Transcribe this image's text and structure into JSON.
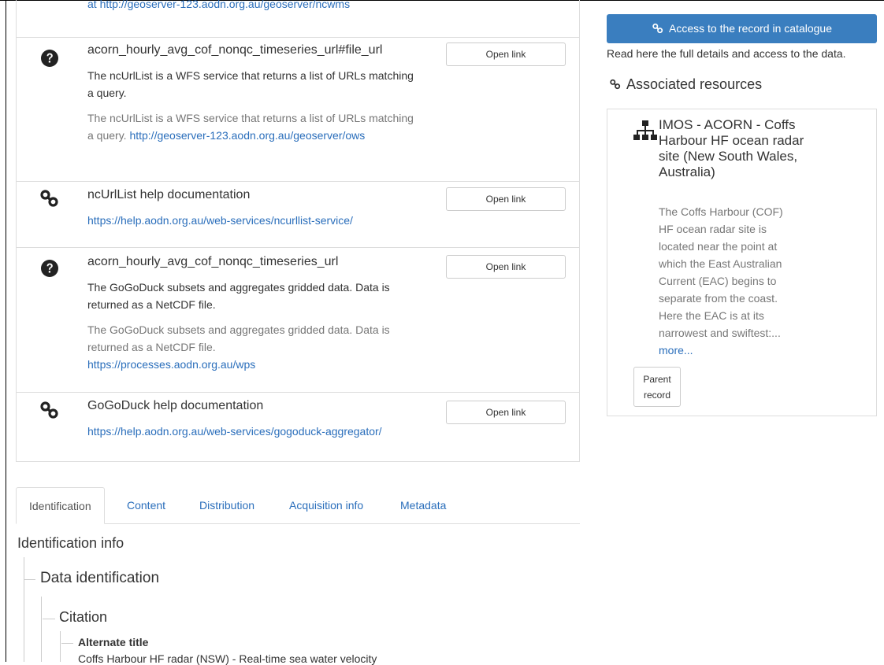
{
  "resources": {
    "cut_top_link": "at http://geoserver-123.aodn.org.au/geoserver/ncwms",
    "rows": [
      {
        "icon": "question-circle-icon",
        "title": "acorn_hourly_avg_cof_nonqc_timeseries_url#file_url",
        "desc": "The ncUrlList is a WFS service that returns a list of URLs matching a query.",
        "muted_desc": "The ncUrlList is a WFS service that returns a list of URLs matching a query.",
        "link": "http://geoserver-123.aodn.org.au/geoserver/ows",
        "button": "Open link"
      },
      {
        "icon": "link-icon",
        "title": "ncUrlList help documentation",
        "link": "https://help.aodn.org.au/web-services/ncurllist-service/",
        "button": "Open link"
      },
      {
        "icon": "question-circle-icon",
        "title": "acorn_hourly_avg_cof_nonqc_timeseries_url",
        "desc": "The GoGoDuck subsets and aggregates gridded data. Data is returned as a NetCDF file.",
        "muted_desc": "The GoGoDuck subsets and aggregates gridded data. Data is returned as a NetCDF file.",
        "link": "https://processes.aodn.org.au/wps",
        "button": "Open link"
      },
      {
        "icon": "link-icon",
        "title": "GoGoDuck help documentation",
        "link": "https://help.aodn.org.au/web-services/gogoduck-aggregator/",
        "button": "Open link"
      }
    ]
  },
  "sidebar": {
    "access_button": "Access to the record in catalogue",
    "access_desc": "Read here the full details and access to the data.",
    "associated_heading": "Associated resources",
    "associated": {
      "title": "IMOS - ACORN - Coffs Harbour HF ocean radar site (New South Wales, Australia)",
      "description": "The Coffs Harbour (COF) HF ocean radar site is located near the point at which the East Australian Current (EAC) begins to separate from the coast. Here the EAC is at its narrowest and swiftest:...",
      "more": "more...",
      "parent_line1": "Parent",
      "parent_line2": "record"
    }
  },
  "tabs": [
    "Identification",
    "Content",
    "Distribution",
    "Acquisition info",
    "Metadata"
  ],
  "identification": {
    "heading": "Identification info",
    "data_identification": "Data identification",
    "citation": "Citation",
    "alternate_title_label": "Alternate title",
    "alternate_title_value": "Coffs Harbour HF radar (NSW) - Real-time sea water velocity"
  },
  "colors": {
    "accent": "#3a7ebf",
    "link": "#2a6ebb",
    "muted": "#777777",
    "border": "#dddddd"
  }
}
